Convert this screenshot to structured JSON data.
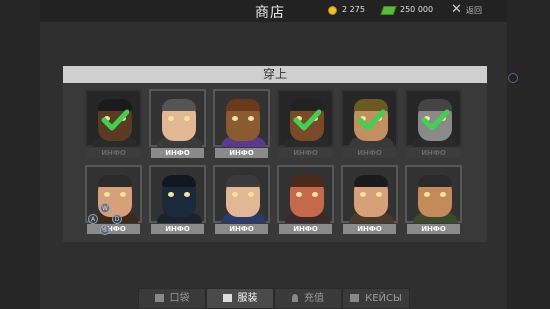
{
  "header": {
    "title": "商店",
    "coins": "2 275",
    "cash": "250 000",
    "close_glyph": "✕",
    "back_label": "返回"
  },
  "section": {
    "title": "穿上"
  },
  "characters": [
    {
      "info": "ИНФО",
      "equipped": true,
      "locked": true,
      "skin": "#5a3a22",
      "hair": "#1a1a1a",
      "shirt": "#2a2a2a"
    },
    {
      "info": "ИНФО",
      "equipped": false,
      "locked": false,
      "skin": "#e2b894",
      "hair": "#555555",
      "shirt": "#3a3a3a"
    },
    {
      "info": "ИНФО",
      "equipped": false,
      "locked": false,
      "skin": "#8a5a30",
      "hair": "#6a3a1a",
      "shirt": "#5a3a8a"
    },
    {
      "info": "ИНФО",
      "equipped": true,
      "locked": true,
      "skin": "#7a4a28",
      "hair": "#222222",
      "shirt": "#2a2a2a"
    },
    {
      "info": "ИНФО",
      "equipped": true,
      "locked": true,
      "skin": "#c09060",
      "hair": "#6a5a20",
      "shirt": "#3a3a3a"
    },
    {
      "info": "ИНФО",
      "equipped": true,
      "locked": true,
      "skin": "#8a8a8a",
      "hair": "#444444",
      "shirt": "#2a2a2a"
    },
    {
      "info": "ИНФО",
      "equipped": false,
      "locked": false,
      "skin": "#d6a07a",
      "hair": "#2a2a2a",
      "shirt": "#3a2a1a"
    },
    {
      "info": "ИНФО",
      "equipped": false,
      "locked": false,
      "skin": "#1a2a3a",
      "hair": "#111820",
      "shirt": "#1a2230"
    },
    {
      "info": "ИНФО",
      "equipped": false,
      "locked": false,
      "skin": "#e2b894",
      "hair": "#3a3a3a",
      "shirt": "#2a3a6a"
    },
    {
      "info": "ИНФО",
      "equipped": false,
      "locked": false,
      "skin": "#c46a4a",
      "hair": "#4a2a1a",
      "shirt": "#3a2a2a"
    },
    {
      "info": "ИНФО",
      "equipped": false,
      "locked": false,
      "skin": "#d6a07a",
      "hair": "#1a1a1a",
      "shirt": "#4a3a2a"
    },
    {
      "info": "ИНФО",
      "equipped": false,
      "locked": false,
      "skin": "#c48a5a",
      "hair": "#2a2a2a",
      "shirt": "#3a4a2a"
    }
  ],
  "tabs": [
    {
      "label": "口袋",
      "icon": "pocket-icon",
      "active": false
    },
    {
      "label": "服装",
      "icon": "shirt-icon",
      "active": true
    },
    {
      "label": "充值",
      "icon": "gem-icon",
      "active": false
    },
    {
      "label": "КЕЙСЫ",
      "icon": "case-icon",
      "active": false
    }
  ],
  "controls": {
    "keys": [
      "W",
      "A",
      "S",
      "D"
    ]
  },
  "colors": {
    "check": "#3fd14f",
    "coin": "#f0c030",
    "cash": "#5dbb3a"
  }
}
